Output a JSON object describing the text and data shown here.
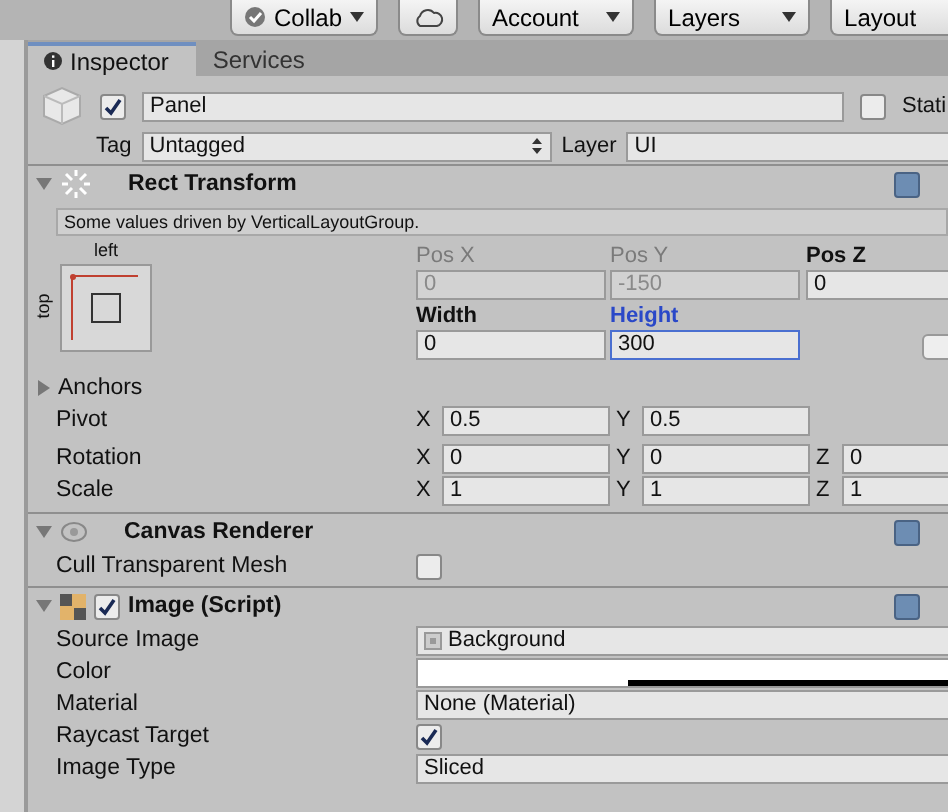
{
  "toolbar": [
    {
      "kind": "menu",
      "label": "Collab",
      "check": true
    },
    {
      "kind": "cloud"
    },
    {
      "kind": "menu",
      "label": "Account"
    },
    {
      "kind": "menu",
      "label": "Layers"
    },
    {
      "kind": "plain",
      "label": "Layout"
    }
  ],
  "tabs": [
    {
      "label": "Inspector",
      "selected": true
    },
    {
      "label": "Services",
      "selected": false
    }
  ],
  "object": {
    "active": true,
    "name": "Panel",
    "static_label": "Stati",
    "static": false,
    "tag_label": "Tag",
    "tag": "Untagged",
    "layer_label": "Layer",
    "layer": "UI"
  },
  "rect_transform": {
    "title": "Rect Transform",
    "expanded": true,
    "note": "Some values driven by VerticalLayoutGroup.",
    "anchor_h": "left",
    "anchor_v": "top",
    "fields": [
      {
        "label": "Pos X",
        "value": "0",
        "disabled": true,
        "selected": false
      },
      {
        "label": "Pos Y",
        "value": "-150",
        "disabled": true,
        "selected": false
      },
      {
        "label": "Pos Z",
        "value": "0",
        "disabled": false,
        "selected": false
      },
      {
        "label": "Width",
        "value": "0",
        "disabled": false,
        "selected": false
      },
      {
        "label": "Height",
        "value": "300",
        "disabled": false,
        "selected": true
      }
    ],
    "anchors": {
      "label": "Anchors",
      "expanded": false
    },
    "vectors": [
      {
        "label": "Pivot",
        "axes": [
          {
            "axis": "X",
            "value": "0.5"
          },
          {
            "axis": "Y",
            "value": "0.5"
          }
        ]
      },
      {
        "label": "Rotation",
        "axes": [
          {
            "axis": "X",
            "value": "0"
          },
          {
            "axis": "Y",
            "value": "0"
          },
          {
            "axis": "Z",
            "value": "0"
          }
        ]
      },
      {
        "label": "Scale",
        "axes": [
          {
            "axis": "X",
            "value": "1"
          },
          {
            "axis": "Y",
            "value": "1"
          },
          {
            "axis": "Z",
            "value": "1"
          }
        ]
      }
    ]
  },
  "components": [
    {
      "title": "Canvas Renderer",
      "expanded": true,
      "props": [
        {
          "kind": "checkbox",
          "label": "Cull Transparent Mesh",
          "checked": false
        }
      ]
    },
    {
      "title": "Image (Script)",
      "enabled": true,
      "expanded": true,
      "props": [
        {
          "kind": "object",
          "label": "Source Image",
          "value": "Background"
        },
        {
          "kind": "color",
          "label": "Color",
          "color": "#ffffff"
        },
        {
          "kind": "text",
          "label": "Material",
          "value": "None (Material)"
        },
        {
          "kind": "checkbox",
          "label": "Raycast Target",
          "checked": true
        },
        {
          "kind": "dropdown",
          "label": "Image Type",
          "value": "Sliced"
        }
      ]
    }
  ]
}
